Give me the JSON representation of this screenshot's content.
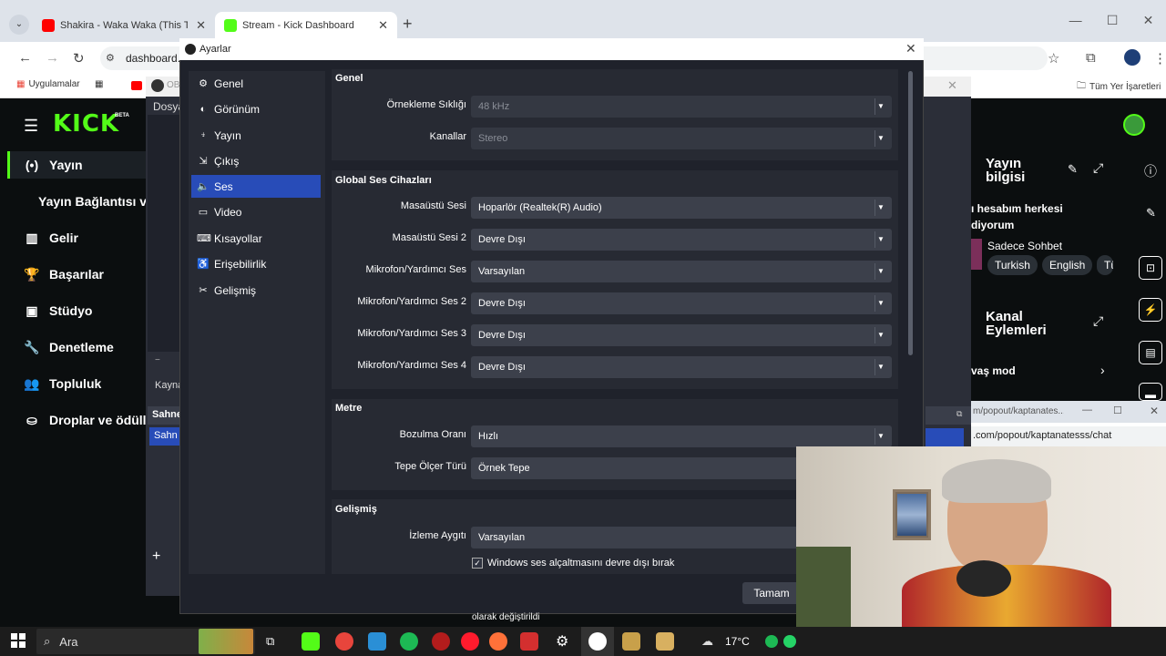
{
  "browser": {
    "tabs": [
      {
        "label": "Shakira - Waka Waka (This Time"
      },
      {
        "label": "Stream - Kick Dashboard"
      }
    ],
    "address": "dashboard.",
    "bookmarks": {
      "apps": "Uygulamalar",
      "all": "Tüm Yer İşaretleri",
      "obs_partial": "OB"
    }
  },
  "kick": {
    "logo": "KICK",
    "beta": "BETA",
    "sidebar": [
      {
        "label": "Yayın",
        "icon": "broadcast-icon"
      },
      {
        "label": "Yayın Bağlantısı ve",
        "icon": ""
      },
      {
        "label": "Gelir",
        "icon": "chart-icon"
      },
      {
        "label": "Başarılar",
        "icon": "trophy-icon"
      },
      {
        "label": "Stüdyo",
        "icon": "studio-icon"
      },
      {
        "label": "Denetleme",
        "icon": "wrench-icon"
      },
      {
        "label": "Topluluk",
        "icon": "community-icon"
      },
      {
        "label": "Droplar ve ödülle",
        "icon": "drops-icon"
      }
    ],
    "stream_info": {
      "title": "Yayın bilgisi",
      "text1": "ı hesabım herkesi",
      "text2": "diyorum",
      "category": "Sadece Sohbet",
      "tags": [
        "Turkish",
        "English",
        "Tü"
      ]
    },
    "channel_actions": {
      "title": "Kanal Eylemleri",
      "item": "vaş mod"
    }
  },
  "obs_back": {
    "menu": "Dosya",
    "sources": "Kayna",
    "scenes": "Sahne",
    "scene_item": "Sahn"
  },
  "popout": {
    "title": "m/popout/kaptanates...",
    "url": ".com/popout/kaptanatesss/chat"
  },
  "dialog": {
    "title": "Ayarlar",
    "nav": [
      {
        "label": "Genel",
        "icon": "gear-icon"
      },
      {
        "label": "Görünüm",
        "icon": "appearance-icon"
      },
      {
        "label": "Yayın",
        "icon": "antenna-icon"
      },
      {
        "label": "Çıkış",
        "icon": "output-icon"
      },
      {
        "label": "Ses",
        "icon": "speaker-icon"
      },
      {
        "label": "Video",
        "icon": "monitor-icon"
      },
      {
        "label": "Kısayollar",
        "icon": "keyboard-icon"
      },
      {
        "label": "Erişebilirlik",
        "icon": "accessibility-icon"
      },
      {
        "label": "Gelişmiş",
        "icon": "tools-icon"
      }
    ],
    "sections": {
      "general": {
        "title": "Genel",
        "sample_rate": {
          "label": "Örnekleme Sıklığı",
          "value": "48 kHz"
        },
        "channels": {
          "label": "Kanallar",
          "value": "Stereo"
        }
      },
      "global_audio": {
        "title": "Global Ses Cihazları",
        "rows": [
          {
            "label": "Masaüstü Sesi",
            "value": "Hoparlör (Realtek(R) Audio)"
          },
          {
            "label": "Masaüstü Sesi 2",
            "value": "Devre Dışı"
          },
          {
            "label": "Mikrofon/Yardımcı Ses",
            "value": "Varsayılan"
          },
          {
            "label": "Mikrofon/Yardımcı Ses 2",
            "value": "Devre Dışı"
          },
          {
            "label": "Mikrofon/Yardımcı Ses 3",
            "value": "Devre Dışı"
          },
          {
            "label": "Mikrofon/Yardımcı Ses 4",
            "value": "Devre Dışı"
          }
        ]
      },
      "meter": {
        "title": "Metre",
        "decay": {
          "label": "Bozulma Oranı",
          "value": "Hızlı"
        },
        "peak": {
          "label": "Tepe Ölçer Türü",
          "value": "Örnek Tepe"
        }
      },
      "advanced": {
        "title": "Gelişmiş",
        "monitor": {
          "label": "İzleme Aygıtı",
          "value": "Varsayılan"
        },
        "ducking": {
          "label": "Windows ses alçaltmasını devre dışı bırak",
          "checked": true
        }
      }
    },
    "ok": "Tamam",
    "status_partial": "olarak değiştirildi"
  },
  "taskbar": {
    "search": "Ara",
    "weather": "17°C"
  },
  "colors": {
    "kick_green": "#53fc18",
    "obs_bg": "#1f222b",
    "obs_accent": "#284cb8"
  }
}
